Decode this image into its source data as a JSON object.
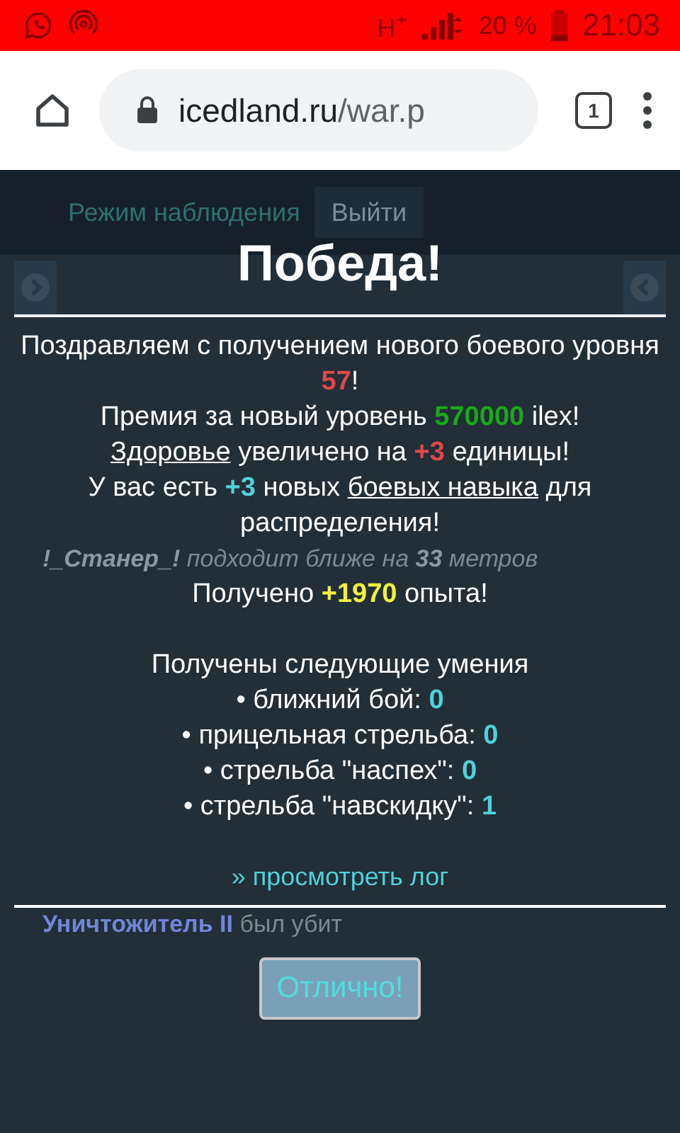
{
  "status_bar": {
    "network": "H$^{+}$",
    "battery": "20 %",
    "time": "21:03"
  },
  "browser": {
    "host": "icedland.ru",
    "path": "/war.p",
    "tab_count": "1"
  },
  "page": {
    "mode_label": "Режим наблюдения",
    "exit_button": "Выйти",
    "log": [
      {
        "kind": "move",
        "text": "**!_Станер_!** подходит ближе на **33** метров"
      },
      {
        "kind": "kill",
        "text": "**Уничтожитель II** был убит"
      }
    ]
  },
  "dialog": {
    "title": "Победа!",
    "lines": [
      [
        {
          "kind": "text",
          "text": "Поздравляем с получением нового боевого уровня "
        },
        {
          "kind": "number",
          "text": "57",
          "color": "#e04848"
        },
        {
          "kind": "text",
          "text": "!"
        }
      ],
      [
        {
          "kind": "text",
          "text": "Премия за новый уровень "
        },
        {
          "kind": "number",
          "text": "570000",
          "color": "#1aa81a"
        },
        {
          "kind": "text",
          "text": " ilex!"
        }
      ],
      [
        {
          "kind": "link",
          "text": "Здоровье"
        },
        {
          "kind": "text",
          "text": " увеличено на "
        },
        {
          "kind": "number",
          "text": "+3",
          "color": "#e04848"
        },
        {
          "kind": "text",
          "text": " единицы!"
        }
      ],
      [
        {
          "kind": "text",
          "text": "У вас есть "
        },
        {
          "kind": "number",
          "text": "+3",
          "color": "#4fd1d9"
        },
        {
          "kind": "text",
          "text": " новых "
        },
        {
          "kind": "link",
          "text": "боевых навыка"
        },
        {
          "kind": "text",
          "text": " для распределения!"
        }
      ]
    ],
    "experience": [
      {
        "kind": "text",
        "text": "Получено "
      },
      {
        "kind": "number",
        "text": "+1970",
        "color": "#f2f23a"
      },
      {
        "kind": "text",
        "text": " опыта!"
      }
    ],
    "skills_heading": "Получены следующие умения",
    "skills": [
      {
        "label": "• ближний бой: ",
        "value": "0"
      },
      {
        "label": "• прицельная стрельба: ",
        "value": "0"
      },
      {
        "label": "• стрельба \"наспех\": ",
        "value": "0"
      },
      {
        "label": "• стрельба \"навскидку\": ",
        "value": "1"
      }
    ],
    "log_link": "» просмотреть лог",
    "ok_button": "Отлично!"
  }
}
